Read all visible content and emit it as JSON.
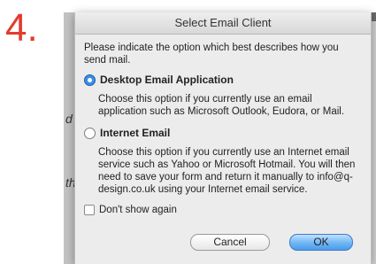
{
  "step": {
    "number": "4."
  },
  "background": {
    "glyph_1": "d",
    "glyph_2": "th"
  },
  "dialog": {
    "title": "Select Email Client",
    "intro": "Please indicate the option which best describes how you send mail.",
    "options": [
      {
        "label": "Desktop Email Application",
        "selected": true,
        "description": "Choose this option if you currently use an email application such as Microsoft Outlook, Eudora, or Mail."
      },
      {
        "label": "Internet Email",
        "selected": false,
        "description": "Choose this option if you currently use an Internet email service such as Yahoo or Microsoft Hotmail. You will then need to save your form and return it manually to info@q-design.co.uk using your Internet email service."
      }
    ],
    "dont_show_again_label": "Don't show again",
    "dont_show_again_checked": false,
    "buttons": {
      "cancel": "Cancel",
      "ok": "OK"
    }
  },
  "colors": {
    "step_number": "#e23c2c",
    "radio_selected": "#3a8ee6",
    "ok_button": "#6fb5f4"
  }
}
